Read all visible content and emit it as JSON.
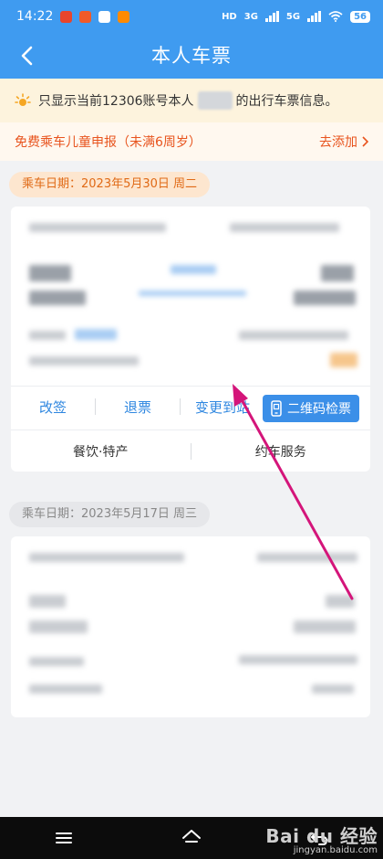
{
  "status_bar": {
    "time": "14:22",
    "hd": "HD",
    "net1": "3G",
    "net2": "5G",
    "battery": "56",
    "app_icons": [
      {
        "name": "app-icon-1",
        "color": "#e8452c"
      },
      {
        "name": "app-icon-2",
        "color": "#f05a28"
      },
      {
        "name": "app-icon-3",
        "color": "#ffffff"
      },
      {
        "name": "app-icon-4",
        "color": "#ff8a00"
      }
    ]
  },
  "nav": {
    "title": "本人车票",
    "back_icon": "chevron-left-icon"
  },
  "notice": {
    "icon": "sun-icon",
    "text_before": "只显示当前12306账号本人",
    "text_after": "的出行车票信息。"
  },
  "child_declare": {
    "label": "免费乘车儿童申报（未满6周岁）",
    "action": "去添加"
  },
  "trips": [
    {
      "date_label": "乘车日期：2023年5月30日 周二",
      "actions": [
        "改签",
        "退票",
        "变更到站"
      ],
      "qr_button": "二维码检票",
      "services": [
        "餐饮·特产",
        "约车服务"
      ]
    },
    {
      "date_label": "乘车日期：2023年5月17日 周三"
    }
  ],
  "watermark": {
    "logo": "Bai du 经验",
    "url": "jingyan.baidu.com"
  },
  "colors": {
    "primary": "#3f9bf0",
    "accent_orange": "#e8541e",
    "link_blue": "#2f87e0",
    "annotation_arrow": "#d4157a"
  }
}
